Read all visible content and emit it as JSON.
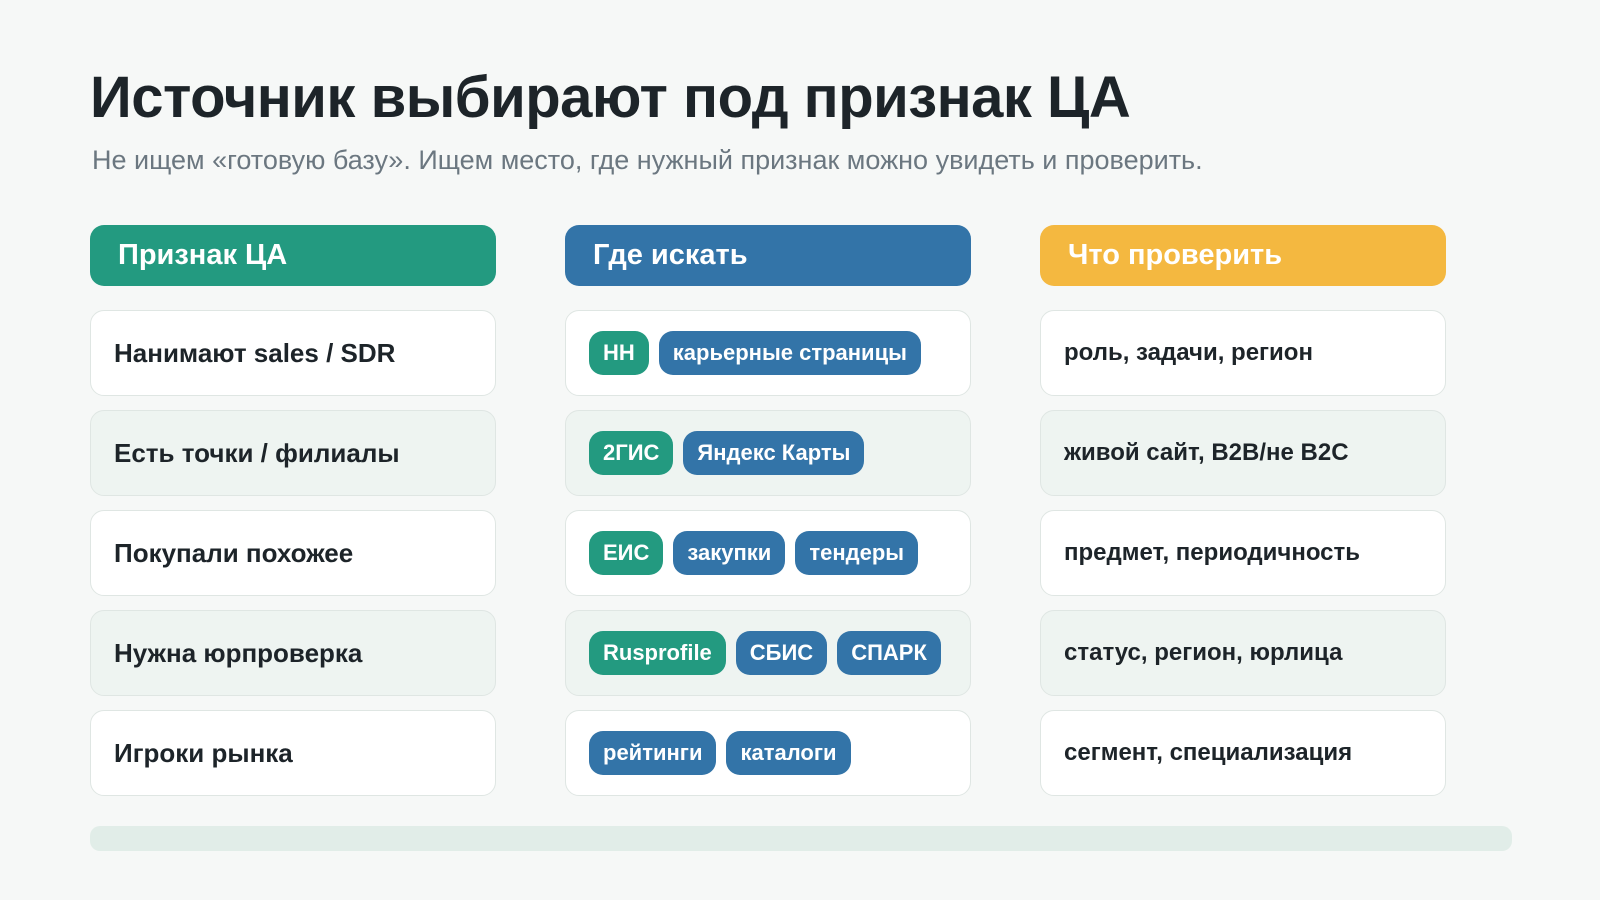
{
  "title": "Источник выбирают под признак ЦА",
  "subtitle": "Не ищем «готовую базу». Ищем место, где нужный признак можно увидеть и проверить.",
  "colors": {
    "green": "#239a80",
    "blue": "#3374a8",
    "yellow": "#f4b840"
  },
  "columns": {
    "trait": {
      "header": "Признак ЦА"
    },
    "where": {
      "header": "Где искать"
    },
    "check": {
      "header": "Что проверить"
    }
  },
  "rows": [
    {
      "trait": "Нанимают sales / SDR",
      "sources": [
        {
          "label": "HH",
          "color": "green"
        },
        {
          "label": "карьерные страницы",
          "color": "blue"
        }
      ],
      "check": "роль, задачи, регион"
    },
    {
      "trait": "Есть точки / филиалы",
      "sources": [
        {
          "label": "2ГИС",
          "color": "green"
        },
        {
          "label": "Яндекс Карты",
          "color": "blue"
        }
      ],
      "check": "живой сайт, B2B/не B2C"
    },
    {
      "trait": "Покупали похожее",
      "sources": [
        {
          "label": "ЕИС",
          "color": "green"
        },
        {
          "label": "закупки",
          "color": "blue"
        },
        {
          "label": "тендеры",
          "color": "blue"
        }
      ],
      "check": "предмет, периодичность"
    },
    {
      "trait": "Нужна юрпроверка",
      "sources": [
        {
          "label": "Rusprofile",
          "color": "green"
        },
        {
          "label": "СБИС",
          "color": "blue"
        },
        {
          "label": "СПАРК",
          "color": "blue"
        }
      ],
      "check": "статус, регион, юрлица"
    },
    {
      "trait": "Игроки рынка",
      "sources": [
        {
          "label": "рейтинги",
          "color": "blue"
        },
        {
          "label": "каталоги",
          "color": "blue"
        }
      ],
      "check": "сегмент, специализация"
    }
  ]
}
